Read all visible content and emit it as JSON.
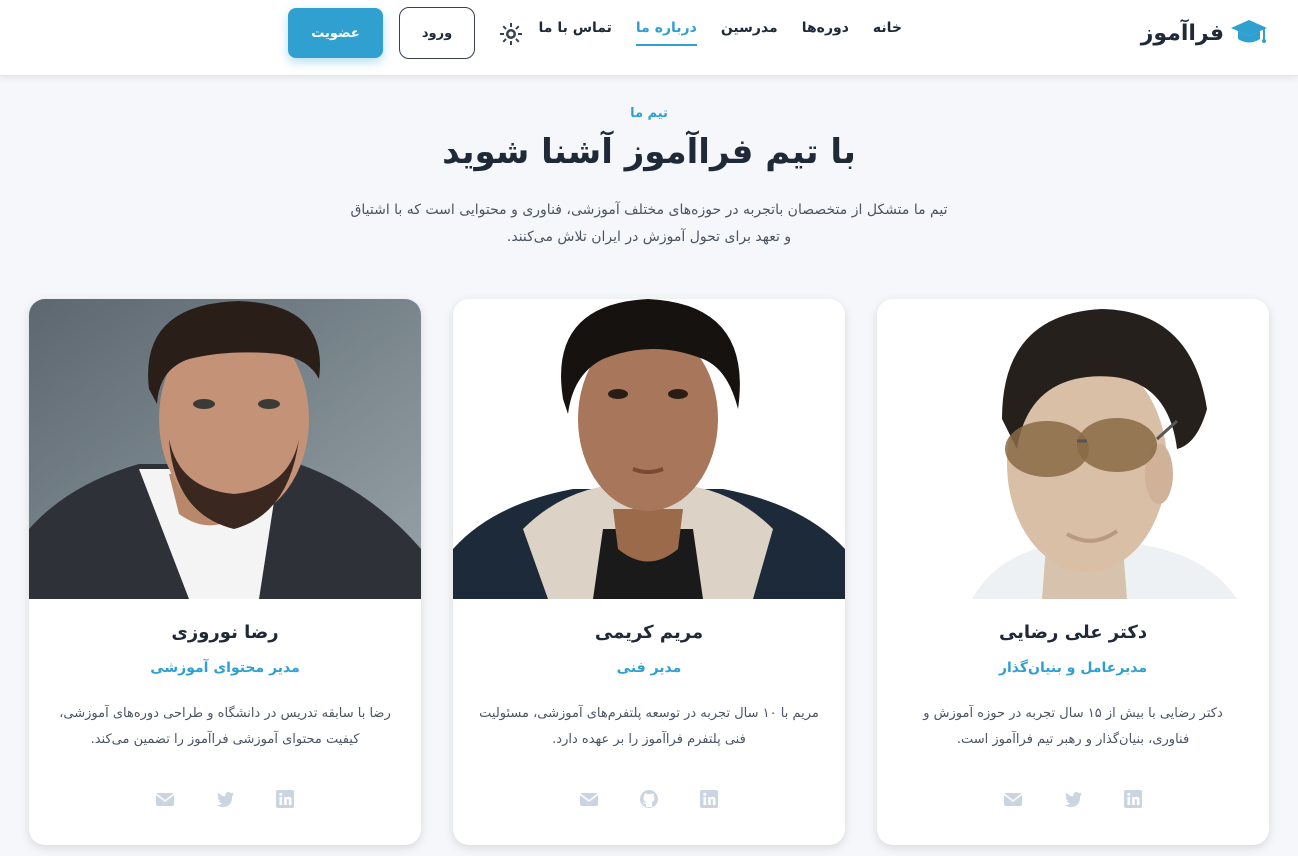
{
  "header": {
    "logo_text": "فراآموز",
    "logo_icon": "graduation-cap-icon",
    "nav": [
      {
        "label": "خانه",
        "active": false
      },
      {
        "label": "دوره‌ها",
        "active": false
      },
      {
        "label": "مدرسین",
        "active": false
      },
      {
        "label": "درباره ما",
        "active": true
      },
      {
        "label": "تماس با ما",
        "active": false
      }
    ],
    "theme_icon": "sun-icon",
    "login_label": "ورود",
    "signup_label": "عضویت"
  },
  "hero": {
    "eyebrow": "تیم ما",
    "title": "با تیم فراآموز آشنا شوید",
    "subtitle": "تیم ما متشکل از متخصصان باتجربه در حوزه‌های مختلف آموزشی، فناوری و محتوایی است که با اشتیاق و تعهد برای تحول آموزش در ایران تلاش می‌کنند."
  },
  "team": [
    {
      "name": "دکتر علی رضایی",
      "role": "مدیرعامل و بنیان‌گذار",
      "bio": "دکتر رضایی با بیش از ۱۵ سال تجربه در حوزه آموزش و فناوری، بنیان‌گذار و رهبر تیم فراآموز است.",
      "social": [
        "linkedin-icon",
        "twitter-icon",
        "email-icon"
      ]
    },
    {
      "name": "مریم کریمی",
      "role": "مدیر فنی",
      "bio": "مریم با ۱۰ سال تجربه در توسعه پلتفرم‌های آموزشی، مسئولیت فنی پلتفرم فراآموز را بر عهده دارد.",
      "social": [
        "linkedin-icon",
        "github-icon",
        "email-icon"
      ]
    },
    {
      "name": "رضا نوروزی",
      "role": "مدیر محتوای آموزشی",
      "bio": "رضا با سابقه تدریس در دانشگاه و طراحی دوره‌های آموزشی، کیفیت محتوای آموزشی فراآموز را تضمین می‌کند.",
      "social": [
        "linkedin-icon",
        "twitter-icon",
        "email-icon"
      ]
    }
  ],
  "colors": {
    "accent": "#2fa0cf",
    "background": "#f5f7fa",
    "text": "#1f2937",
    "muted": "#4b5563",
    "social_icon": "#cbd5e1"
  }
}
